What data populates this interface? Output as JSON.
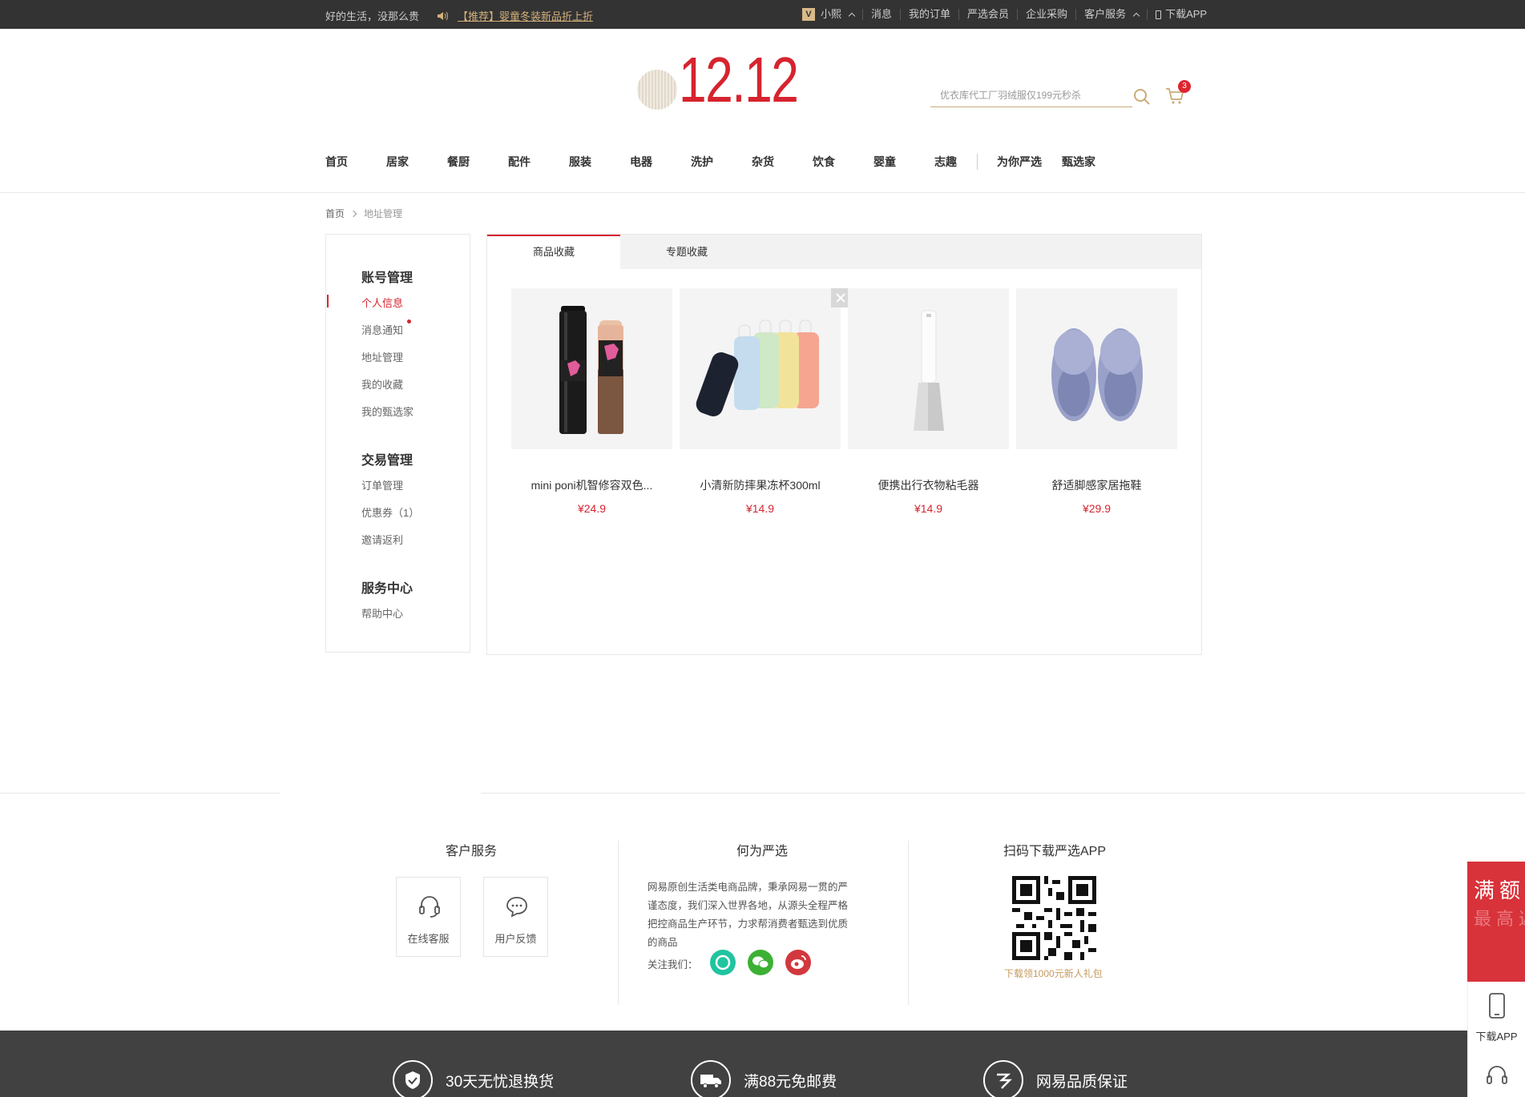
{
  "topbar": {
    "slogan": "好的生活，没那么贵",
    "promo": "【推荐】婴童冬装新品折上折",
    "user": "小熙",
    "links": [
      "消息",
      "我的订单",
      "严选会员",
      "企业采购",
      "客户服务",
      "下载APP"
    ]
  },
  "header": {
    "logo_text": "12.12",
    "search_placeholder": "优衣库代工厂羽绒服仅199元秒杀",
    "cart_count": "3"
  },
  "nav": [
    "首页",
    "居家",
    "餐厨",
    "配件",
    "服装",
    "电器",
    "洗护",
    "杂货",
    "饮食",
    "婴童",
    "志趣",
    "为你严选",
    "甄选家"
  ],
  "breadcrumb": {
    "home": "首页",
    "current": "地址管理"
  },
  "sidebar": {
    "groups": [
      {
        "title": "账号管理",
        "items": [
          "个人信息",
          "消息通知",
          "地址管理",
          "我的收藏",
          "我的甄选家"
        ]
      },
      {
        "title": "交易管理",
        "items": [
          "订单管理",
          "优惠券（1）",
          "邀请返利"
        ]
      },
      {
        "title": "服务中心",
        "items": [
          "帮助中心"
        ]
      }
    ]
  },
  "tabs": [
    "商品收藏",
    "专题收藏"
  ],
  "products": [
    {
      "title": "mini poni机智修容双色...",
      "price": "¥24.9"
    },
    {
      "title": "小清新防摔果冻杯300ml",
      "price": "¥14.9"
    },
    {
      "title": "便携出行衣物粘毛器",
      "price": "¥14.9"
    },
    {
      "title": "舒适脚感家居拖鞋",
      "price": "¥29.9"
    }
  ],
  "footer": {
    "service_title": "客户服务",
    "online_service": "在线客服",
    "feedback": "用户反馈",
    "about_title": "何为严选",
    "about_text": "网易原创生活类电商品牌，秉承网易一贯的严谨态度，我们深入世界各地，从源头全程严格把控商品生产环节，力求帮消费者甄选到优质的商品",
    "follow": "关注我们：",
    "app_title": "扫码下载严选APP",
    "app_caption": "下载领1000元新人礼包",
    "guarantees": [
      "30天无忧退换货",
      "满88元免邮费",
      "网易品质保证"
    ]
  },
  "float": {
    "promo_line1": "满额",
    "promo_line2": "最高返",
    "download": "下载APP"
  },
  "colors": {
    "brand_red": "#d6242f",
    "gold": "#c9ab7a",
    "dark": "#333333"
  }
}
